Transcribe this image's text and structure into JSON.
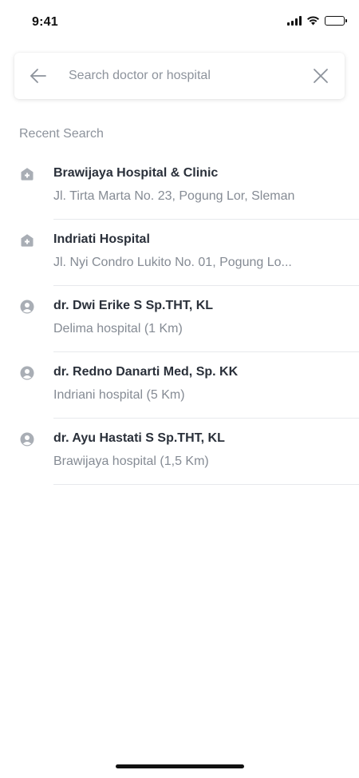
{
  "status_bar": {
    "time": "9:41"
  },
  "search": {
    "placeholder": "Search doctor or hospital",
    "value": ""
  },
  "recent": {
    "title": "Recent Search",
    "items": [
      {
        "type": "hospital",
        "icon": "hospital-icon",
        "title": "Brawijaya Hospital & Clinic",
        "subtitle": "Jl. Tirta Marta No. 23, Pogung Lor, Sleman"
      },
      {
        "type": "hospital",
        "icon": "hospital-icon",
        "title": "Indriati Hospital",
        "subtitle": "Jl. Nyi Condro Lukito No. 01, Pogung Lo..."
      },
      {
        "type": "doctor",
        "icon": "person-icon",
        "title": "dr. Dwi Erike S Sp.THT, KL",
        "subtitle": "Delima hospital (1 Km)"
      },
      {
        "type": "doctor",
        "icon": "person-icon",
        "title": "dr. Redno Danarti Med, Sp. KK",
        "subtitle": "Indriani hospital (5 Km)"
      },
      {
        "type": "doctor",
        "icon": "person-icon",
        "title": "dr. Ayu Hastati S Sp.THT, KL",
        "subtitle": "Brawijaya hospital (1,5 Km)"
      }
    ]
  },
  "colors": {
    "icon_gray": "#a9aeb5",
    "text_primary": "#2a303a",
    "text_secondary": "#858b94",
    "divider": "#e7e9ec"
  }
}
